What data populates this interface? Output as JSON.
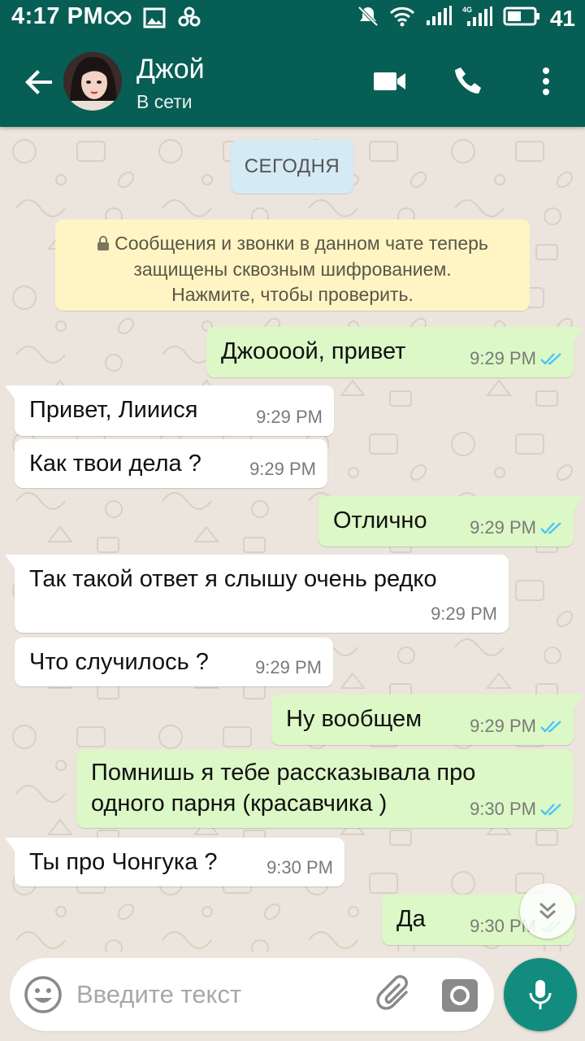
{
  "status_bar": {
    "time": "4:17 PM",
    "battery": "41",
    "network_label": "4G",
    "icons": [
      "infinity-icon",
      "image-icon",
      "link-icon",
      "mute-icon",
      "wifi-icon",
      "signal-icon",
      "battery-icon"
    ]
  },
  "header": {
    "contact_name": "Джой",
    "contact_status": "В сети",
    "back_icon": "arrow-left-icon",
    "video_icon": "video-call-icon",
    "call_icon": "phone-icon",
    "menu_icon": "more-vert-icon"
  },
  "chat": {
    "date_label": "СЕГОДНЯ",
    "e2e_notice": {
      "line1": "Сообщения и звонки в данном чате теперь",
      "line2": "защищены сквозным шифрованием.",
      "line3": "Нажмите, чтобы проверить."
    },
    "messages": [
      {
        "dir": "out",
        "text": "Джоооой, привет",
        "time": "9:29 PM",
        "status": "read"
      },
      {
        "dir": "in",
        "text": "Привет, Лииися",
        "time": "9:29 PM"
      },
      {
        "dir": "in",
        "text": "Как твои дела ?",
        "time": "9:29 PM"
      },
      {
        "dir": "out",
        "text": "Отлично",
        "time": "9:29 PM",
        "status": "read"
      },
      {
        "dir": "in",
        "text": "Так такой ответ я слышу очень редко",
        "time": "9:29 PM"
      },
      {
        "dir": "in",
        "text": "Что случилось ?",
        "time": "9:29 PM"
      },
      {
        "dir": "out",
        "text": "Ну вообщем",
        "time": "9:29 PM",
        "status": "read"
      },
      {
        "dir": "out",
        "text_line1": "Помнишь я тебе рассказывала про",
        "text_line2": "одного парня (красавчика )",
        "time": "9:30 PM",
        "status": "read"
      },
      {
        "dir": "in",
        "text": "Ты про Чонгука ?",
        "time": "9:30 PM"
      },
      {
        "dir": "out",
        "text": "Да",
        "time": "9:30 PM",
        "status": "read"
      }
    ]
  },
  "composer": {
    "placeholder": "Введите текст"
  },
  "colors": {
    "header": "#075E54",
    "accent": "#128C7E",
    "outgoing_bubble": "#DCF8C6",
    "incoming_bubble": "#FFFFFF",
    "read_ticks": "#4FC3F7",
    "wallpaper": "#ECE5DD"
  }
}
